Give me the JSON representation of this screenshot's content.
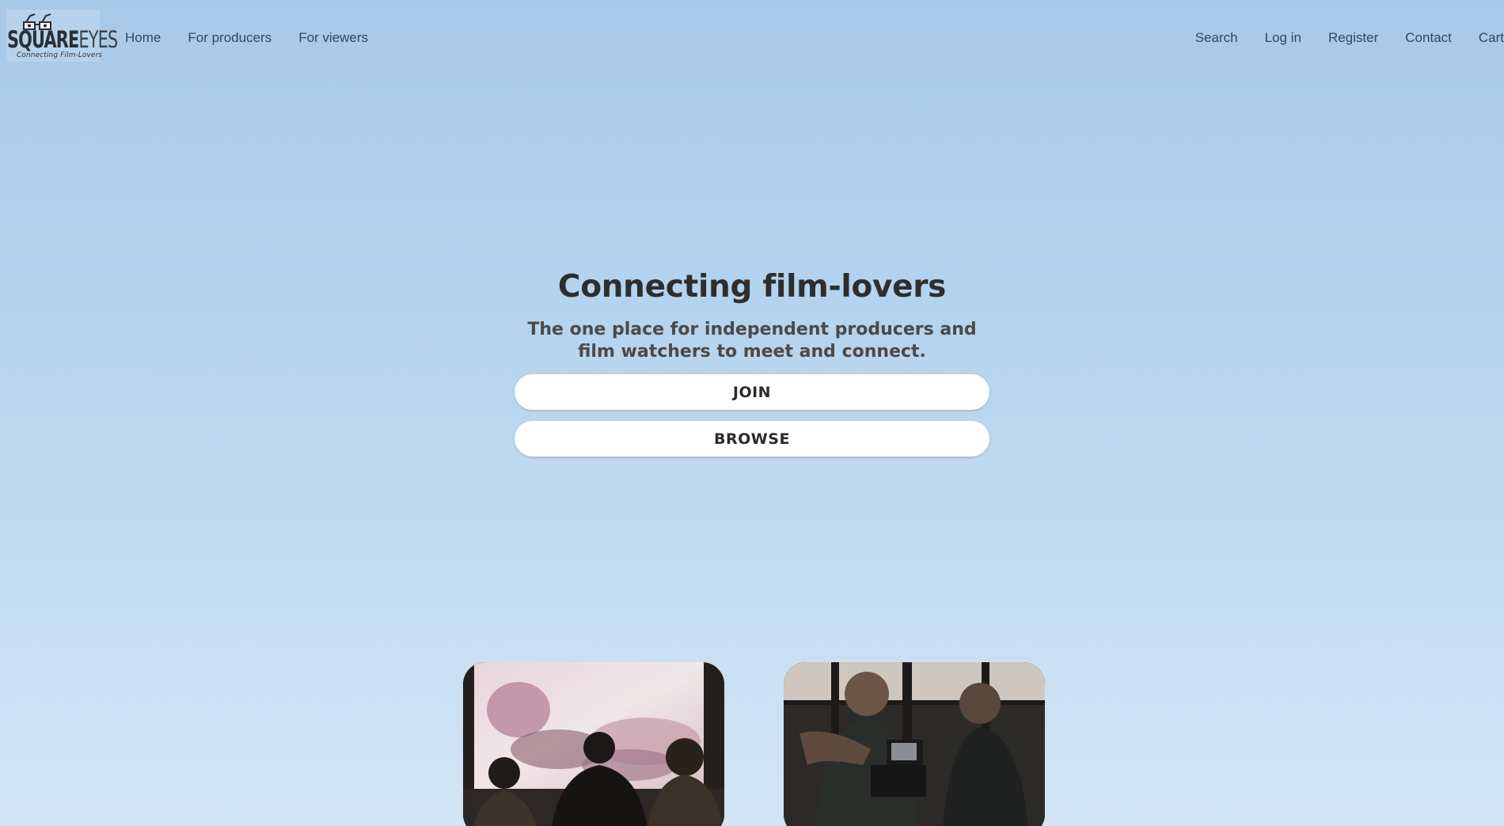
{
  "logo": {
    "brand_part1": "SQUARE",
    "brand_part2": "EYES",
    "tagline": "Connecting Film-Lovers"
  },
  "nav": {
    "left": [
      {
        "label": "Home"
      },
      {
        "label": "For producers"
      },
      {
        "label": "For viewers"
      }
    ],
    "right": [
      {
        "label": "Search"
      },
      {
        "label": "Log in"
      },
      {
        "label": "Register"
      },
      {
        "label": "Contact"
      },
      {
        "label": "Cart"
      }
    ]
  },
  "hero": {
    "title": "Connecting film-lovers",
    "subtitle": "The one place for independent producers and film watchers to meet and connect.",
    "join_label": "JOIN",
    "browse_label": "BROWSE"
  },
  "colors": {
    "background_top": "#a9cbe9",
    "background_bottom": "#d2e5f5",
    "button_bg": "#ffffff",
    "nav_text": "#2f4a63"
  },
  "images": [
    {
      "subject": "audience-silhouettes-watching-screen"
    },
    {
      "subject": "camera-operator-filming"
    }
  ]
}
